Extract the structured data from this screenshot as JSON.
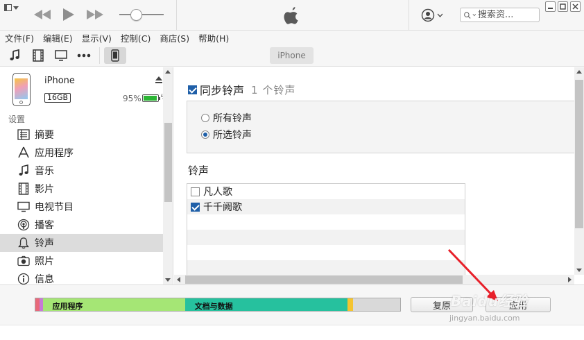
{
  "search": {
    "placeholder": "搜索资..."
  },
  "menu": [
    "文件(F)",
    "编辑(E)",
    "显示(V)",
    "控制(C)",
    "商店(S)",
    "帮助(H)"
  ],
  "toolbar": {
    "device_pill": "iPhone"
  },
  "device": {
    "name": "iPhone",
    "capacity": "16GB",
    "battery_pct": "95%",
    "battery_level": 0.95
  },
  "sidebar": {
    "section": "设置",
    "items": [
      {
        "label": "摘要",
        "icon": "summary-icon"
      },
      {
        "label": "应用程序",
        "icon": "apps-icon"
      },
      {
        "label": "音乐",
        "icon": "music-note-icon"
      },
      {
        "label": "影片",
        "icon": "film-icon"
      },
      {
        "label": "电视节目",
        "icon": "tv-icon"
      },
      {
        "label": "播客",
        "icon": "podcast-icon"
      },
      {
        "label": "铃声",
        "icon": "bell-icon",
        "selected": true
      },
      {
        "label": "照片",
        "icon": "camera-icon"
      },
      {
        "label": "信息",
        "icon": "info-icon"
      }
    ]
  },
  "main": {
    "sync_label": "同步铃声",
    "sync_count": "1 个铃声",
    "sync_checked": true,
    "options": [
      {
        "label": "所有铃声",
        "selected": false
      },
      {
        "label": "所选铃声",
        "selected": true
      }
    ],
    "ringtone_heading": "铃声",
    "ringtones": [
      {
        "name": "凡人歌",
        "checked": false
      },
      {
        "name": "千千阙歌",
        "checked": true
      }
    ]
  },
  "storage": {
    "segments": [
      {
        "label": "",
        "color": "#e8697a",
        "fraction": 0.012
      },
      {
        "label": "",
        "color": "#c77ad6",
        "fraction": 0.008
      },
      {
        "label": "应用程序",
        "color": "#a5e675",
        "fraction": 0.39
      },
      {
        "label": "文档与数据",
        "color": "#26c19e",
        "fraction": 0.445
      },
      {
        "label": "",
        "color": "#f4c430",
        "fraction": 0.016
      },
      {
        "label": "",
        "color": "#d9d9d9",
        "fraction": 0.129
      }
    ]
  },
  "buttons": {
    "revert": "复原",
    "apply": "应用"
  },
  "watermark": {
    "text": "Baidu经验",
    "url": "jingyan.baidu.com"
  },
  "colors": {
    "accent": "#1f5fa8",
    "annotation_arrow": "#e8202a"
  }
}
